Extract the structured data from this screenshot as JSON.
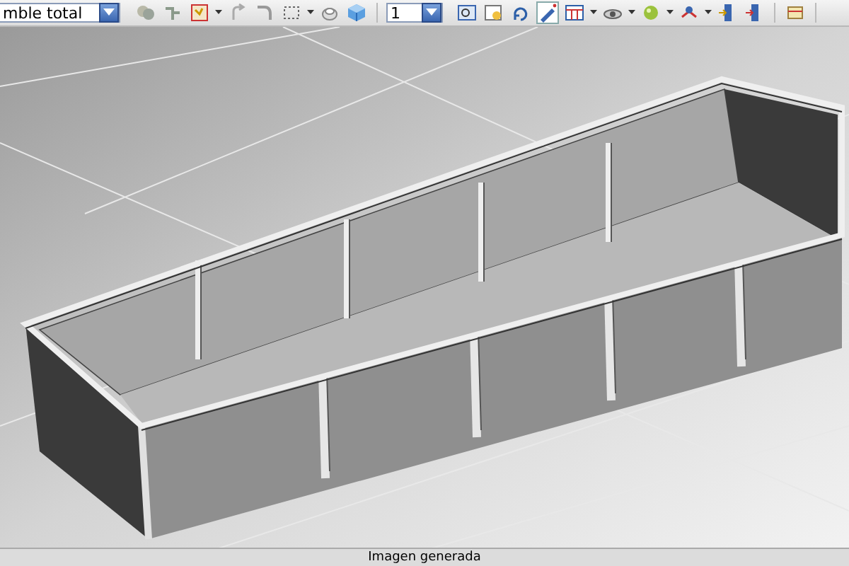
{
  "toolbar": {
    "assembly_select": {
      "value": "mble total"
    },
    "scale_select": {
      "value": "1"
    }
  },
  "status_bar": {
    "text": "Imagen generada"
  }
}
